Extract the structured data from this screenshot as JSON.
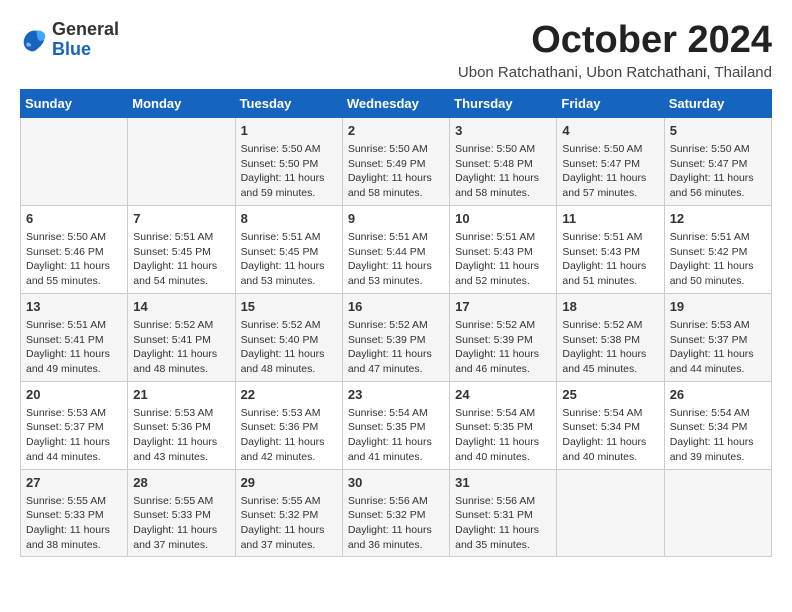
{
  "header": {
    "logo": {
      "general": "General",
      "blue": "Blue"
    },
    "title": "October 2024",
    "subtitle": "Ubon Ratchathani, Ubon Ratchathani, Thailand"
  },
  "calendar": {
    "weekdays": [
      "Sunday",
      "Monday",
      "Tuesday",
      "Wednesday",
      "Thursday",
      "Friday",
      "Saturday"
    ],
    "weeks": [
      [
        {
          "day": "",
          "info": ""
        },
        {
          "day": "",
          "info": ""
        },
        {
          "day": "1",
          "info": "Sunrise: 5:50 AM\nSunset: 5:50 PM\nDaylight: 11 hours and 59 minutes."
        },
        {
          "day": "2",
          "info": "Sunrise: 5:50 AM\nSunset: 5:49 PM\nDaylight: 11 hours and 58 minutes."
        },
        {
          "day": "3",
          "info": "Sunrise: 5:50 AM\nSunset: 5:48 PM\nDaylight: 11 hours and 58 minutes."
        },
        {
          "day": "4",
          "info": "Sunrise: 5:50 AM\nSunset: 5:47 PM\nDaylight: 11 hours and 57 minutes."
        },
        {
          "day": "5",
          "info": "Sunrise: 5:50 AM\nSunset: 5:47 PM\nDaylight: 11 hours and 56 minutes."
        }
      ],
      [
        {
          "day": "6",
          "info": "Sunrise: 5:50 AM\nSunset: 5:46 PM\nDaylight: 11 hours and 55 minutes."
        },
        {
          "day": "7",
          "info": "Sunrise: 5:51 AM\nSunset: 5:45 PM\nDaylight: 11 hours and 54 minutes."
        },
        {
          "day": "8",
          "info": "Sunrise: 5:51 AM\nSunset: 5:45 PM\nDaylight: 11 hours and 53 minutes."
        },
        {
          "day": "9",
          "info": "Sunrise: 5:51 AM\nSunset: 5:44 PM\nDaylight: 11 hours and 53 minutes."
        },
        {
          "day": "10",
          "info": "Sunrise: 5:51 AM\nSunset: 5:43 PM\nDaylight: 11 hours and 52 minutes."
        },
        {
          "day": "11",
          "info": "Sunrise: 5:51 AM\nSunset: 5:43 PM\nDaylight: 11 hours and 51 minutes."
        },
        {
          "day": "12",
          "info": "Sunrise: 5:51 AM\nSunset: 5:42 PM\nDaylight: 11 hours and 50 minutes."
        }
      ],
      [
        {
          "day": "13",
          "info": "Sunrise: 5:51 AM\nSunset: 5:41 PM\nDaylight: 11 hours and 49 minutes."
        },
        {
          "day": "14",
          "info": "Sunrise: 5:52 AM\nSunset: 5:41 PM\nDaylight: 11 hours and 48 minutes."
        },
        {
          "day": "15",
          "info": "Sunrise: 5:52 AM\nSunset: 5:40 PM\nDaylight: 11 hours and 48 minutes."
        },
        {
          "day": "16",
          "info": "Sunrise: 5:52 AM\nSunset: 5:39 PM\nDaylight: 11 hours and 47 minutes."
        },
        {
          "day": "17",
          "info": "Sunrise: 5:52 AM\nSunset: 5:39 PM\nDaylight: 11 hours and 46 minutes."
        },
        {
          "day": "18",
          "info": "Sunrise: 5:52 AM\nSunset: 5:38 PM\nDaylight: 11 hours and 45 minutes."
        },
        {
          "day": "19",
          "info": "Sunrise: 5:53 AM\nSunset: 5:37 PM\nDaylight: 11 hours and 44 minutes."
        }
      ],
      [
        {
          "day": "20",
          "info": "Sunrise: 5:53 AM\nSunset: 5:37 PM\nDaylight: 11 hours and 44 minutes."
        },
        {
          "day": "21",
          "info": "Sunrise: 5:53 AM\nSunset: 5:36 PM\nDaylight: 11 hours and 43 minutes."
        },
        {
          "day": "22",
          "info": "Sunrise: 5:53 AM\nSunset: 5:36 PM\nDaylight: 11 hours and 42 minutes."
        },
        {
          "day": "23",
          "info": "Sunrise: 5:54 AM\nSunset: 5:35 PM\nDaylight: 11 hours and 41 minutes."
        },
        {
          "day": "24",
          "info": "Sunrise: 5:54 AM\nSunset: 5:35 PM\nDaylight: 11 hours and 40 minutes."
        },
        {
          "day": "25",
          "info": "Sunrise: 5:54 AM\nSunset: 5:34 PM\nDaylight: 11 hours and 40 minutes."
        },
        {
          "day": "26",
          "info": "Sunrise: 5:54 AM\nSunset: 5:34 PM\nDaylight: 11 hours and 39 minutes."
        }
      ],
      [
        {
          "day": "27",
          "info": "Sunrise: 5:55 AM\nSunset: 5:33 PM\nDaylight: 11 hours and 38 minutes."
        },
        {
          "day": "28",
          "info": "Sunrise: 5:55 AM\nSunset: 5:33 PM\nDaylight: 11 hours and 37 minutes."
        },
        {
          "day": "29",
          "info": "Sunrise: 5:55 AM\nSunset: 5:32 PM\nDaylight: 11 hours and 37 minutes."
        },
        {
          "day": "30",
          "info": "Sunrise: 5:56 AM\nSunset: 5:32 PM\nDaylight: 11 hours and 36 minutes."
        },
        {
          "day": "31",
          "info": "Sunrise: 5:56 AM\nSunset: 5:31 PM\nDaylight: 11 hours and 35 minutes."
        },
        {
          "day": "",
          "info": ""
        },
        {
          "day": "",
          "info": ""
        }
      ]
    ]
  }
}
